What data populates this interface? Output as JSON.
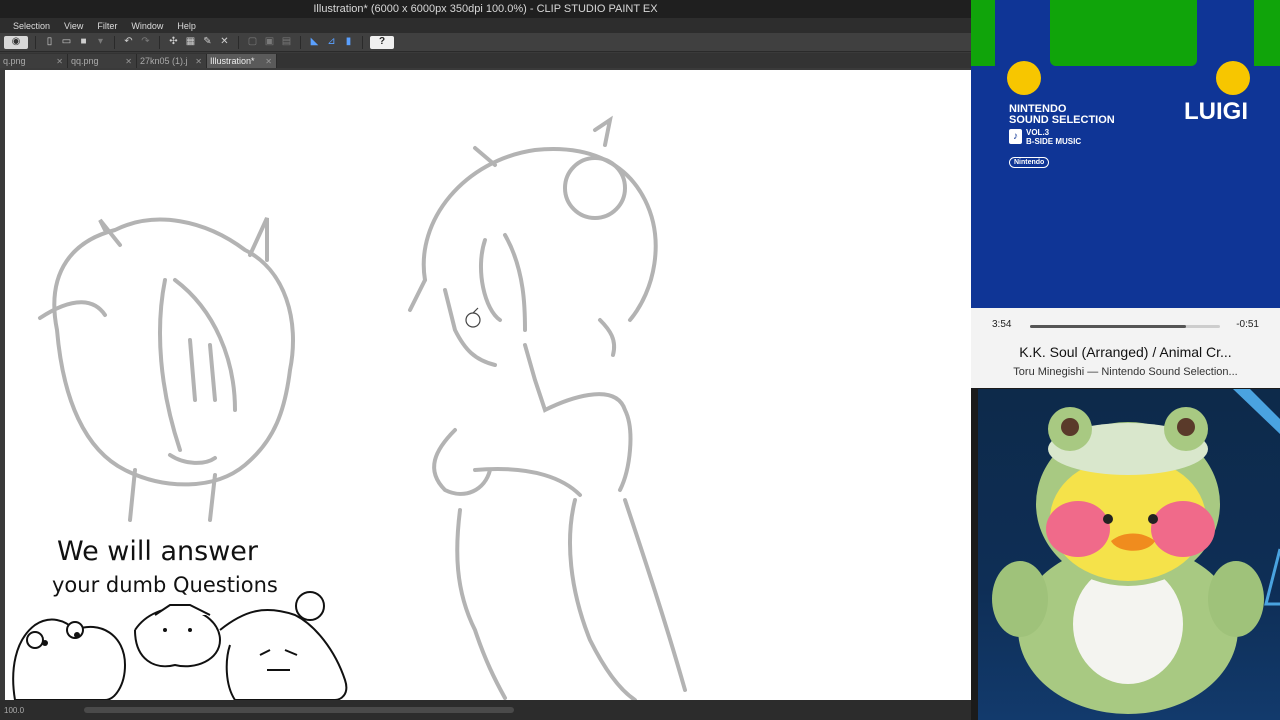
{
  "window": {
    "title": "Illustration* (6000 x 6000px 350dpi 100.0%)  - CLIP STUDIO PAINT EX"
  },
  "menu": {
    "items": [
      "Selection",
      "View",
      "Filter",
      "Window",
      "Help"
    ]
  },
  "toolbar": {
    "icons": [
      "user-mode-icon",
      "new-file-icon",
      "open-file-icon",
      "save-icon",
      "undo-icon",
      "redo-icon",
      "transform-icon",
      "fill-icon",
      "clear-icon",
      "cut-icon",
      "copy-icon",
      "ruler-icon",
      "snap-icon",
      "help-icon"
    ]
  },
  "tabs": [
    {
      "label": "q.png",
      "active": false
    },
    {
      "label": "qq.png",
      "active": false
    },
    {
      "label": "27kn05 (1).j",
      "active": false
    },
    {
      "label": "Illustration*",
      "active": true
    }
  ],
  "canvas": {
    "sign_line1": "We will answer",
    "sign_line2": "your dumb Questions"
  },
  "status": {
    "zoom": "100.0"
  },
  "player": {
    "album_series_line1": "NINTENDO",
    "album_series_line2": "SOUND SELECTION",
    "album_vol_line1": "VOL.3",
    "album_vol_line2": "B-SIDE MUSIC",
    "album_brand": "Nintendo",
    "album_name": "LUIGI",
    "elapsed": "3:54",
    "remaining": "-0:51",
    "progress": 0.82,
    "track_title": "K.K. Soul (Arranged) / Animal Cr...",
    "track_artist": "Toru Minegishi — Nintendo Sound Selection..."
  },
  "colors": {
    "album_blue": "#0f3596",
    "album_green": "#10a40a",
    "album_yellow": "#f7c600",
    "accent_blue": "#5aa0ff"
  }
}
